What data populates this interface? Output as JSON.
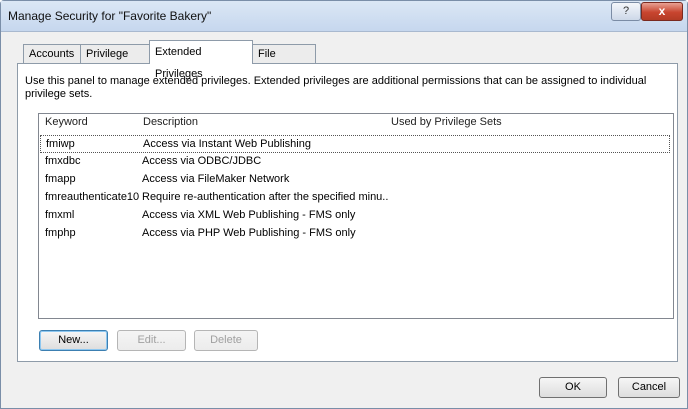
{
  "window": {
    "title": "Manage Security for \"Favorite Bakery\"",
    "help_glyph": "?",
    "close_glyph": "x"
  },
  "tabs": [
    {
      "label": "Accounts"
    },
    {
      "label": "Privilege Sets"
    },
    {
      "label": "Extended Privileges"
    },
    {
      "label": "File Access"
    }
  ],
  "description": "Use this panel to manage extended privileges. Extended privileges are additional permissions that can be assigned to individual privilege sets.",
  "table": {
    "columns": [
      "Keyword",
      "Description",
      "Used by Privilege Sets"
    ],
    "rows": [
      {
        "keyword": "fmiwp",
        "description": "Access via Instant Web Publishing",
        "used_by": ""
      },
      {
        "keyword": "fmxdbc",
        "description": "Access via ODBC/JDBC",
        "used_by": ""
      },
      {
        "keyword": "fmapp",
        "description": "Access via FileMaker Network",
        "used_by": ""
      },
      {
        "keyword": "fmreauthenticate10",
        "description": "Require re-authentication after the specified minu...",
        "used_by": ""
      },
      {
        "keyword": "fmxml",
        "description": "Access via XML Web Publishing - FMS only",
        "used_by": ""
      },
      {
        "keyword": "fmphp",
        "description": "Access via PHP Web Publishing - FMS only",
        "used_by": ""
      }
    ]
  },
  "buttons": {
    "new": "New...",
    "edit": "Edit...",
    "delete": "Delete",
    "ok": "OK",
    "cancel": "Cancel"
  }
}
